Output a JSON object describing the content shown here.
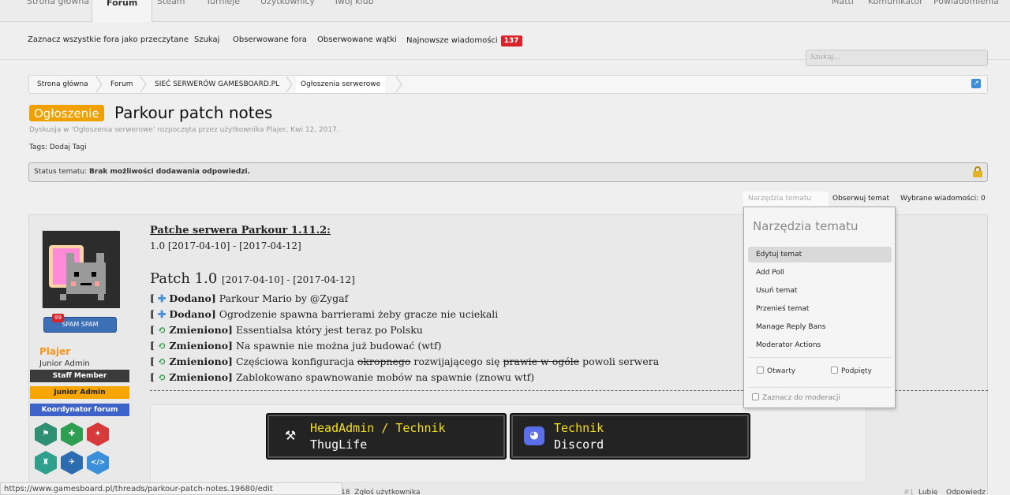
{
  "top_nav": {
    "tabs": [
      "Strona główna",
      "Forum",
      "Steam",
      "Turnieje",
      "Użytkownicy",
      "Twój klub"
    ],
    "active_tab": "Forum",
    "right": [
      "Matti",
      "Komunikator",
      "Powiadomienia"
    ]
  },
  "sub_nav": {
    "links": [
      "Zaznacz wszystkie fora jako przeczytane",
      "Szukaj",
      "Obserwowane fora",
      "Obserwowane wątki",
      "Najnowsze wiadomości"
    ],
    "new_count": "137"
  },
  "search": {
    "placeholder": "Szukaj..."
  },
  "breadcrumb": [
    "Strona główna",
    "Forum",
    "SIEĆ SERWERÓW GAMESBOARD.PL",
    "Ogłoszenia serwerowe"
  ],
  "thread": {
    "prefix": "Ogłoszenie",
    "title": "Parkour patch notes",
    "description": "Dyskusja w 'Ogłoszenia serwerowe' rozpoczęta przez użytkownika Plajer, Kwi 12, 2017.",
    "tags_label": "Tags:",
    "tags_action": "Dodaj Tagi",
    "status_label": "Status tematu:",
    "status_value": "Brak możliwości dodawania odpowiedzi."
  },
  "controls": {
    "thread_tools": "Narzędzia tematu",
    "follow": "Obserwuj temat",
    "selected": "Wybrane wiadomości: 0"
  },
  "dropdown": {
    "heading": "Narzędzia tematu",
    "items": [
      "Edytuj temat",
      "Add Poll",
      "Usuń temat",
      "Przenieś temat",
      "Manage Reply Bans",
      "Moderator Actions"
    ],
    "check_sticky_a": "Otwarty",
    "check_sticky_b": "Podpięty",
    "check_mod": "Zaznacz do moderacji"
  },
  "author": {
    "spam_count": "99",
    "spam_label": "SPAM SPAM",
    "name": "Plajer",
    "title": "Junior Admin",
    "banners": [
      "Staff Member",
      "Junior Admin",
      "Koordynator forum"
    ],
    "banner_colors": [
      "#3b3b3b",
      "#f7a600",
      "#3d63c9"
    ]
  },
  "post": {
    "heading": "Patche serwera Parkour 1.11.2:",
    "versions": "1.0 [2017-04-10] - [2017-04-12]",
    "patch_title": "Patch 1.0",
    "patch_dates": "[2017-04-10] - [2017-04-12]",
    "lines": [
      {
        "tag": "Dodano",
        "icon": "plus",
        "text": "Parkour Mario by @Zygaf"
      },
      {
        "tag": "Dodano",
        "icon": "plus",
        "text": "Ogrodzenie spawna barrierami żeby gracze nie uciekali"
      },
      {
        "tag": "Zmieniono",
        "icon": "cycle",
        "text": "Essentialsa który jest teraz po Polsku"
      },
      {
        "tag": "Zmieniono",
        "icon": "cycle",
        "text": "Na spawnie nie można już budować (wtf)"
      },
      {
        "tag": "Zmieniono",
        "icon": "cycle",
        "text_pre": "Częściowa konfiguracja",
        "strike1": "okropnego",
        "text_mid": "rozwijającego się",
        "strike2": "prawie w ogóle",
        "text_post": "powoli serwera"
      },
      {
        "tag": "Zmieniono",
        "icon": "cycle",
        "text": "Zablokowano spawnowanie mobów na spawnie (znowu wtf)"
      }
    ]
  },
  "signature": {
    "btn1_l1": "HeadAdmin / Technik",
    "btn1_l2": "ThugLife",
    "btn2_l1": "Technik",
    "btn2_l2": "Discord"
  },
  "footer": {
    "statusbar_url": "https://www.gamesboard.pl/threads/parkour-patch-notes.19680/edit",
    "report_prefix": "18",
    "report": "Zgłoś użytkownika",
    "post_num": "#1",
    "like": "Lubię",
    "reply": "Odpowiedz"
  }
}
